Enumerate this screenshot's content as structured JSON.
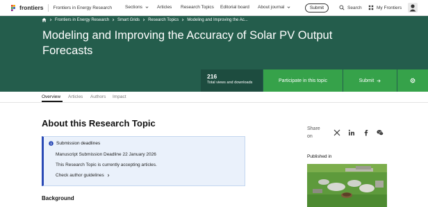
{
  "nav": {
    "brand": "frontiers",
    "journal": "Frontiers in Energy Research",
    "links": [
      {
        "label": "Sections",
        "dropdown": true
      },
      {
        "label": "Articles",
        "dropdown": false
      },
      {
        "label": "Research Topics",
        "dropdown": false
      },
      {
        "label": "Editorial board",
        "dropdown": false
      },
      {
        "label": "About journal",
        "dropdown": true
      }
    ],
    "submit_label": "Submit",
    "search_label": "Search",
    "my_frontiers_label": "My Frontiers",
    "icons": [
      "frontiers-logo-icon",
      "search-icon",
      "grid-icon",
      "avatar-icon"
    ]
  },
  "hero": {
    "breadcrumb": [
      "Frontiers in Energy Research",
      "Smart Grids",
      "Research Topics",
      "Modeling and Improving the Ac..."
    ],
    "title": "Modeling and Improving the Accuracy of Solar PV Output Forecasts",
    "stats_value": "216",
    "stats_label": "Total views and downloads",
    "participate_label": "Participate in this topic",
    "submit_label": "Submit",
    "colors": {
      "hero_bg": "#245d4c",
      "stats_bg": "#1d4c3f",
      "action_green": "#36a24a"
    }
  },
  "tabs": [
    {
      "label": "Overview",
      "active": true
    },
    {
      "label": "Articles",
      "active": false
    },
    {
      "label": "Authors",
      "active": false
    },
    {
      "label": "Impact",
      "active": false
    }
  ],
  "main": {
    "section_title": "About this Research Topic",
    "deadlines": {
      "heading": "Submission deadlines",
      "manuscript": "Manuscript Submission Deadline 22 January 2026",
      "status": "This Research Topic is currently accepting articles.",
      "guidelines": "Check author guidelines"
    },
    "background_heading": "Background"
  },
  "sidebar": {
    "share_label": "Share on",
    "share_icons": [
      "x-icon",
      "linkedin-icon",
      "facebook-icon",
      "wechat-icon"
    ],
    "published_label": "Published in"
  }
}
